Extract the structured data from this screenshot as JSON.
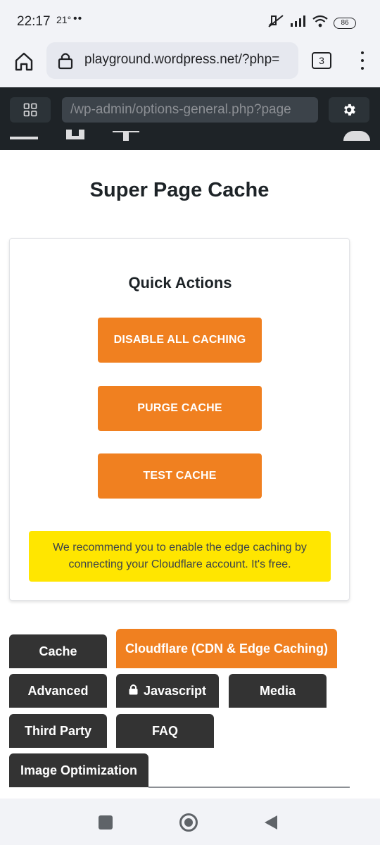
{
  "status_bar": {
    "time": "22:17",
    "temperature": "21°",
    "dots": "••",
    "battery": "86"
  },
  "browser": {
    "url": "playground.wordpress.net/?php=",
    "tab_count": "3"
  },
  "playground": {
    "url_field": "/wp-admin/options-general.php?page"
  },
  "page": {
    "title": "Super Page Cache"
  },
  "quick_actions": {
    "title": "Quick Actions",
    "buttons": [
      "DISABLE ALL CACHING",
      "PURGE CACHE",
      "TEST CACHE"
    ],
    "notice": "We recommend you to enable the edge caching by connecting your Cloudflare account. It's free."
  },
  "tabs": [
    {
      "label": "Cache",
      "active": false
    },
    {
      "label": "Cloudflare (CDN & Edge Caching)",
      "active": true
    },
    {
      "label": "Advanced",
      "active": false
    },
    {
      "label": "Javascript",
      "active": false,
      "locked": true
    },
    {
      "label": "Media",
      "active": false
    },
    {
      "label": "Third Party",
      "active": false
    },
    {
      "label": "FAQ",
      "active": false
    },
    {
      "label": "Image Optimization",
      "active": false
    }
  ],
  "colors": {
    "accent_orange": "#f08020",
    "tab_dark": "#333333",
    "notice_yellow": "#ffe600",
    "admin_bar": "#1e2327"
  }
}
